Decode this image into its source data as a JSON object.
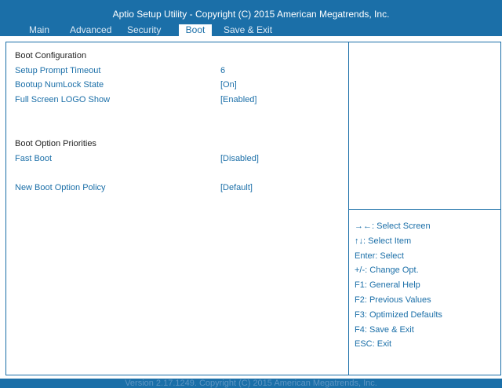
{
  "header": {
    "title": "Aptio Setup Utility - Copyright  (C)  2015 American Megatrends, Inc.",
    "tabs": [
      "Main",
      "Advanced",
      "Security",
      "Boot",
      "Save & Exit"
    ],
    "active_tab": "Boot"
  },
  "boot": {
    "section1_heading": "Boot Configuration",
    "setup_prompt_timeout": {
      "label": "Setup Prompt Timeout",
      "value": "6"
    },
    "bootup_numlock_state": {
      "label": "Bootup NumLock State",
      "value": "[On]"
    },
    "full_screen_logo_show": {
      "label": "Full Screen LOGO Show",
      "value": "[Enabled]"
    },
    "section2_heading": "Boot Option Priorities",
    "fast_boot": {
      "label": "Fast Boot",
      "value": "[Disabled]"
    },
    "new_boot_option_policy": {
      "label": "New Boot Option Policy",
      "value": "[Default]"
    }
  },
  "help": [
    "→←: Select Screen",
    "↑↓: Select Item",
    "Enter: Select",
    "+/-: Change Opt.",
    "F1: General Help",
    "F2: Previous Values",
    "F3: Optimized Defaults",
    "F4: Save & Exit",
    "ESC: Exit"
  ],
  "footer": {
    "text": "Version 2.17.1249. Copyright  (C)  2015 American Megatrends, Inc."
  },
  "colors": {
    "accent": "#1b6fa8",
    "background": "#ffffff",
    "text": "#222222"
  }
}
